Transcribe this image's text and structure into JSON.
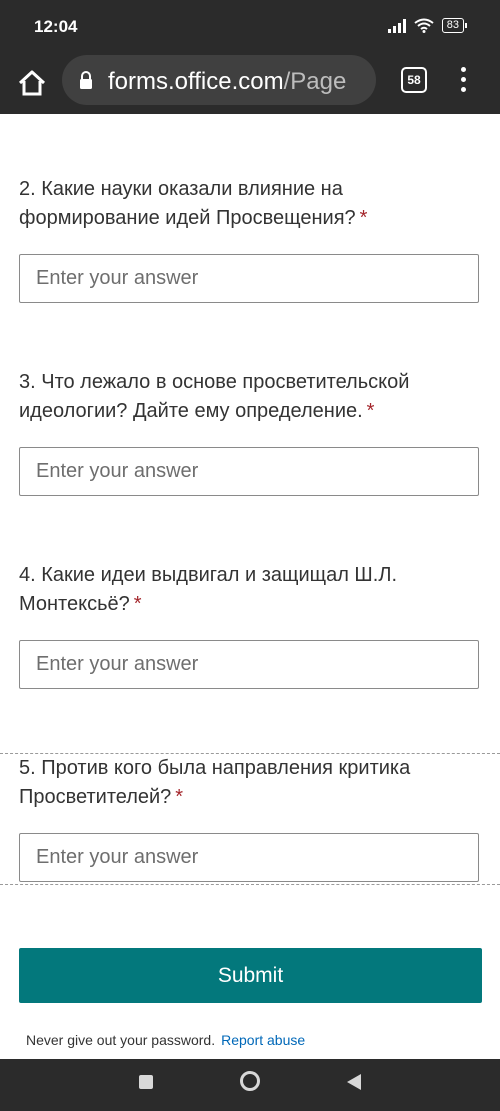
{
  "status_bar": {
    "time": "12:04",
    "battery": "83"
  },
  "browser": {
    "url_domain": "forms.office.com",
    "url_path": "/Page",
    "tab_count": "58"
  },
  "questions": [
    {
      "title": "2. Какие науки оказали влияние на формирование идей Просвещения?",
      "required_mark": "*",
      "placeholder": "Enter your answer"
    },
    {
      "title": "3. Что лежало в основе просветительской идеологии? Дайте ему определение.",
      "required_mark": "*",
      "placeholder": "Enter your answer"
    },
    {
      "title": "4. Какие идеи выдвигал и защищал Ш.Л. Монтексьё?",
      "required_mark": "*",
      "placeholder": "Enter your answer"
    },
    {
      "title": "5. Против кого была направления критика Просветителей?",
      "required_mark": "*",
      "placeholder": "Enter your answer"
    }
  ],
  "submit_label": "Submit",
  "footer": {
    "note": "Never give out your password.",
    "report_link": "Report abuse"
  },
  "colors": {
    "accent": "#03787c",
    "required": "#a4262c",
    "link": "#0068b8"
  }
}
